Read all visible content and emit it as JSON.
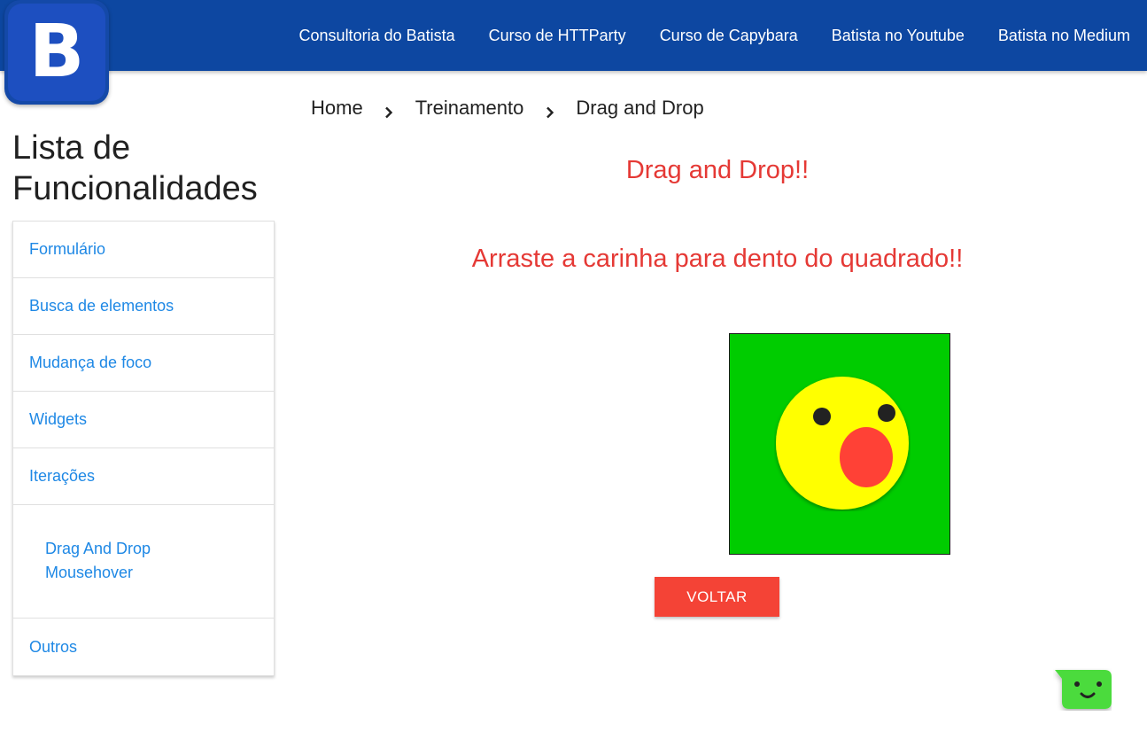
{
  "header": {
    "logo_letter": "B",
    "nav": [
      "Consultoria do Batista",
      "Curso de HTTParty",
      "Curso de Capybara",
      "Batista no Youtube",
      "Batista no Medium"
    ]
  },
  "sidebar": {
    "title_line1": "Lista de",
    "title_line2": "Funcionalidades",
    "items": [
      "Formulário",
      "Busca de elementos",
      "Mudança de foco",
      "Widgets",
      "Iterações"
    ],
    "sub_items": [
      "Drag And Drop",
      "Mousehover"
    ],
    "last_item": "Outros"
  },
  "breadcrumb": [
    "Home",
    "Treinamento",
    "Drag and Drop"
  ],
  "main": {
    "title": "Drag and Drop!!",
    "instruction": "Arraste a carinha para dento do quadrado!!",
    "back_button": "VOLTAR"
  },
  "colors": {
    "nav_bg": "#0d47a1",
    "link": "#1e88e5",
    "heading_red": "#e53935",
    "drop_green": "#00cc00",
    "face_yellow": "#ffff00",
    "mouth_red": "#ff4136",
    "button_red": "#f44336",
    "chat_green": "#4cdb3c"
  }
}
